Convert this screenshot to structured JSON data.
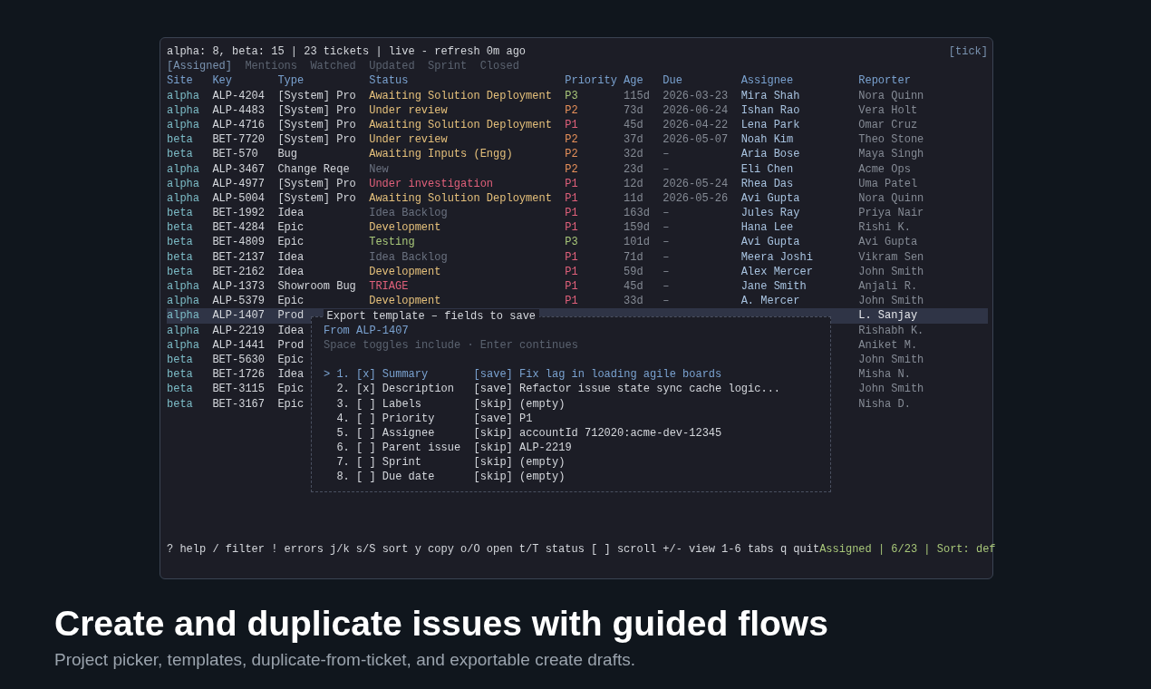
{
  "terminal": {
    "summary": "alpha: 8, beta: 15 | 23 tickets | live - refresh 0m ago",
    "tick": "[tick]",
    "tabs": [
      {
        "label": "[Assigned]",
        "selected": true
      },
      {
        "label": "Mentions",
        "selected": false
      },
      {
        "label": "Watched",
        "selected": false
      },
      {
        "label": "Updated",
        "selected": false
      },
      {
        "label": "Sprint",
        "selected": false
      },
      {
        "label": "Closed",
        "selected": false
      }
    ],
    "columns": [
      "Site",
      "Key",
      "Type",
      "Status",
      "Priority",
      "Age",
      "Due",
      "Assignee",
      "Reporter"
    ],
    "rows": [
      {
        "site": "alpha",
        "key": "ALP-4204",
        "type": "[System] Pro",
        "status": {
          "text": "Awaiting Solution Deployment",
          "color": "#e5c07b"
        },
        "priority": {
          "text": "P3",
          "color": "#a8c779"
        },
        "age": "115d",
        "due": "2026-03-23",
        "assignee": "Mira Shah",
        "reporter": "Nora Quinn",
        "selected": false
      },
      {
        "site": "alpha",
        "key": "ALP-4483",
        "type": "[System] Pro",
        "status": {
          "text": "Under review",
          "color": "#e5c07b"
        },
        "priority": {
          "text": "P2",
          "color": "#e8915a"
        },
        "age": "73d",
        "due": "2026-06-24",
        "assignee": "Ishan Rao",
        "reporter": "Vera Holt",
        "selected": false
      },
      {
        "site": "alpha",
        "key": "ALP-4716",
        "type": "[System] Pro",
        "status": {
          "text": "Awaiting Solution Deployment",
          "color": "#e5c07b"
        },
        "priority": {
          "text": "P1",
          "color": "#e0607a"
        },
        "age": "45d",
        "due": "2026-04-22",
        "assignee": "Lena Park",
        "reporter": "Omar Cruz",
        "selected": false
      },
      {
        "site": "beta",
        "key": "BET-7720",
        "type": "[System] Pro",
        "status": {
          "text": "Under review",
          "color": "#e5c07b"
        },
        "priority": {
          "text": "P2",
          "color": "#e8915a"
        },
        "age": "37d",
        "due": "2026-05-07",
        "assignee": "Noah Kim",
        "reporter": "Theo Stone",
        "selected": false
      },
      {
        "site": "beta",
        "key": "BET-570",
        "type": "Bug",
        "status": {
          "text": "Awaiting Inputs (Engg)",
          "color": "#e5c07b"
        },
        "priority": {
          "text": "P2",
          "color": "#e8915a"
        },
        "age": "32d",
        "due": "–",
        "assignee": "Aria Bose",
        "reporter": "Maya Singh",
        "selected": false
      },
      {
        "site": "alpha",
        "key": "ALP-3467",
        "type": "Change Reqe",
        "status": {
          "text": "New",
          "color": "#6b7280"
        },
        "priority": {
          "text": "P2",
          "color": "#e8915a"
        },
        "age": "23d",
        "due": "–",
        "assignee": "Eli Chen",
        "reporter": "Acme Ops",
        "selected": false
      },
      {
        "site": "alpha",
        "key": "ALP-4977",
        "type": "[System] Pro",
        "status": {
          "text": "Under investigation",
          "color": "#e0607a"
        },
        "priority": {
          "text": "P1",
          "color": "#e0607a"
        },
        "age": "12d",
        "due": "2026-05-24",
        "assignee": "Rhea Das",
        "reporter": "Uma Patel",
        "selected": false
      },
      {
        "site": "alpha",
        "key": "ALP-5004",
        "type": "[System] Pro",
        "status": {
          "text": "Awaiting Solution Deployment",
          "color": "#e5c07b"
        },
        "priority": {
          "text": "P1",
          "color": "#e0607a"
        },
        "age": "11d",
        "due": "2026-05-26",
        "assignee": "Avi Gupta",
        "reporter": "Nora Quinn",
        "selected": false
      },
      {
        "site": "beta",
        "key": "BET-1992",
        "type": "Idea",
        "status": {
          "text": "Idea Backlog",
          "color": "#6b7280"
        },
        "priority": {
          "text": "P1",
          "color": "#e0607a"
        },
        "age": "163d",
        "due": "–",
        "assignee": "Jules Ray",
        "reporter": "Priya Nair",
        "selected": false
      },
      {
        "site": "beta",
        "key": "BET-4284",
        "type": "Epic",
        "status": {
          "text": "Development",
          "color": "#e5c07b"
        },
        "priority": {
          "text": "P1",
          "color": "#e0607a"
        },
        "age": "159d",
        "due": "–",
        "assignee": "Hana Lee",
        "reporter": "Rishi K.",
        "selected": false
      },
      {
        "site": "beta",
        "key": "BET-4809",
        "type": "Epic",
        "status": {
          "text": "Testing",
          "color": "#a8c779"
        },
        "priority": {
          "text": "P3",
          "color": "#a8c779"
        },
        "age": "101d",
        "due": "–",
        "assignee": "Avi Gupta",
        "reporter": "Avi Gupta",
        "selected": false
      },
      {
        "site": "beta",
        "key": "BET-2137",
        "type": "Idea",
        "status": {
          "text": "Idea Backlog",
          "color": "#6b7280"
        },
        "priority": {
          "text": "P1",
          "color": "#e0607a"
        },
        "age": "71d",
        "due": "–",
        "assignee": "Meera Joshi",
        "reporter": "Vikram Sen",
        "selected": false
      },
      {
        "site": "beta",
        "key": "BET-2162",
        "type": "Idea",
        "status": {
          "text": "Development",
          "color": "#e5c07b"
        },
        "priority": {
          "text": "P1",
          "color": "#e0607a"
        },
        "age": "59d",
        "due": "–",
        "assignee": "Alex Mercer",
        "reporter": "John Smith",
        "selected": false
      },
      {
        "site": "alpha",
        "key": "ALP-1373",
        "type": "Showroom Bug",
        "status": {
          "text": "TRIAGE",
          "color": "#e0607a"
        },
        "priority": {
          "text": "P1",
          "color": "#e0607a"
        },
        "age": "45d",
        "due": "–",
        "assignee": "Jane Smith",
        "reporter": "Anjali R.",
        "selected": false
      },
      {
        "site": "alpha",
        "key": "ALP-5379",
        "type": "Epic",
        "status": {
          "text": "Development",
          "color": "#e5c07b"
        },
        "priority": {
          "text": "P1",
          "color": "#e0607a"
        },
        "age": "33d",
        "due": "–",
        "assignee": "A. Mercer",
        "reporter": "John Smith",
        "selected": false
      },
      {
        "site": "alpha",
        "key": "ALP-1407",
        "type": "Prod",
        "reporter": "L. Sanjay",
        "selected": true
      },
      {
        "site": "alpha",
        "key": "ALP-2219",
        "type": "Idea",
        "reporter": "Rishabh K.",
        "selected": false
      },
      {
        "site": "alpha",
        "key": "ALP-1441",
        "type": "Prod",
        "reporter": "Aniket M.",
        "selected": false
      },
      {
        "site": "beta",
        "key": "BET-5630",
        "type": "Epic",
        "reporter": "John Smith",
        "selected": false
      },
      {
        "site": "beta",
        "key": "BET-1726",
        "type": "Idea",
        "reporter": "Misha N.",
        "selected": false
      },
      {
        "site": "beta",
        "key": "BET-3115",
        "type": "Epic",
        "reporter": "John Smith",
        "selected": false
      },
      {
        "site": "beta",
        "key": "BET-3167",
        "type": "Epic",
        "reporter": "Nisha D.",
        "selected": false
      }
    ],
    "export_dialog": {
      "title": "Export template – fields to save",
      "source": "From ALP-1407",
      "hint": "Space toggles include · Enter continues",
      "cursor": ">",
      "fields": [
        {
          "number": "1.",
          "checkbox": "[x]",
          "label": "Summary",
          "action": "[save]",
          "value": "Fix lag in loading agile boards",
          "selected": true
        },
        {
          "number": "2.",
          "checkbox": "[x]",
          "label": "Description",
          "action": "[save]",
          "value": "Refactor issue state sync cache logic...",
          "selected": false
        },
        {
          "number": "3.",
          "checkbox": "[ ]",
          "label": "Labels",
          "action": "[skip]",
          "value": "(empty)",
          "selected": false
        },
        {
          "number": "4.",
          "checkbox": "[ ]",
          "label": "Priority",
          "action": "[save]",
          "value": "P1",
          "selected": false
        },
        {
          "number": "5.",
          "checkbox": "[ ]",
          "label": "Assignee",
          "action": "[skip]",
          "value": "accountId 712020:acme-dev-12345",
          "selected": false
        },
        {
          "number": "6.",
          "checkbox": "[ ]",
          "label": "Parent issue",
          "action": "[skip]",
          "value": "ALP-2219",
          "selected": false
        },
        {
          "number": "7.",
          "checkbox": "[ ]",
          "label": "Sprint",
          "action": "[skip]",
          "value": "(empty)",
          "selected": false
        },
        {
          "number": "8.",
          "checkbox": "[ ]",
          "label": "Due date",
          "action": "[skip]",
          "value": "(empty)",
          "selected": false
        }
      ]
    },
    "status_bar": {
      "keys": "? help / filter ! errors j/k s/S sort y copy o/O open t/T status [ ] scroll +/- view 1-6 tabs q quit",
      "state": "Assigned | 6/23 | Sort: def"
    }
  },
  "caption": {
    "title": "Create and duplicate issues with guided flows",
    "subtitle": "Project picker, templates, duplicate-from-ticket, and exportable create drafts."
  }
}
